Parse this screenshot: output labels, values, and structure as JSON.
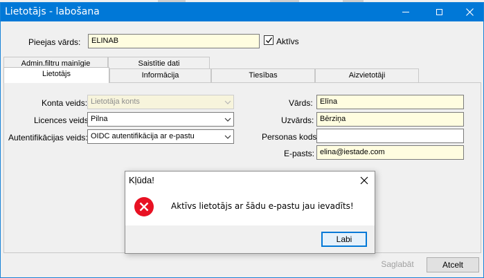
{
  "window": {
    "title": "Lietotājs - labošana",
    "accent": "#0078d7"
  },
  "header": {
    "access_name_label": "Pieejas vārds:",
    "access_name_value": "ELINAB",
    "active_label": "Aktīvs",
    "active_checked": true
  },
  "tabs": {
    "row_back": [
      {
        "label": "Admin.filtru mainīgie"
      },
      {
        "label": "Saistītie dati"
      }
    ],
    "row_front": [
      {
        "label": "Lietotājs",
        "active": true
      },
      {
        "label": "Informācija"
      },
      {
        "label": "Tiesības"
      },
      {
        "label": "Aizvietotāji"
      }
    ]
  },
  "form": {
    "account_type_label": "Konta veids:",
    "account_type_value": "Lietotāja konts",
    "license_type_label": "Licences veids:",
    "license_type_value": "Pilna",
    "auth_type_label": "Autentifikācijas veids:",
    "auth_type_value": "OIDC autentifikācija ar e-pastu",
    "first_name_label": "Vārds:",
    "first_name_value": "Elīna",
    "last_name_label": "Uzvārds:",
    "last_name_value": "Bērziņa",
    "personal_code_label": "Personas kods:",
    "personal_code_value": "",
    "email_label": "E-pasts:",
    "email_value": "elina@iestade.com"
  },
  "footer": {
    "save_label": "Saglabāt",
    "cancel_label": "Atcelt"
  },
  "dialog": {
    "title": "Kļūda!",
    "message": "Aktīvs lietotājs ar šādu e-pastu jau ievadīts!",
    "ok_label": "Labi",
    "error_color": "#e81123"
  }
}
